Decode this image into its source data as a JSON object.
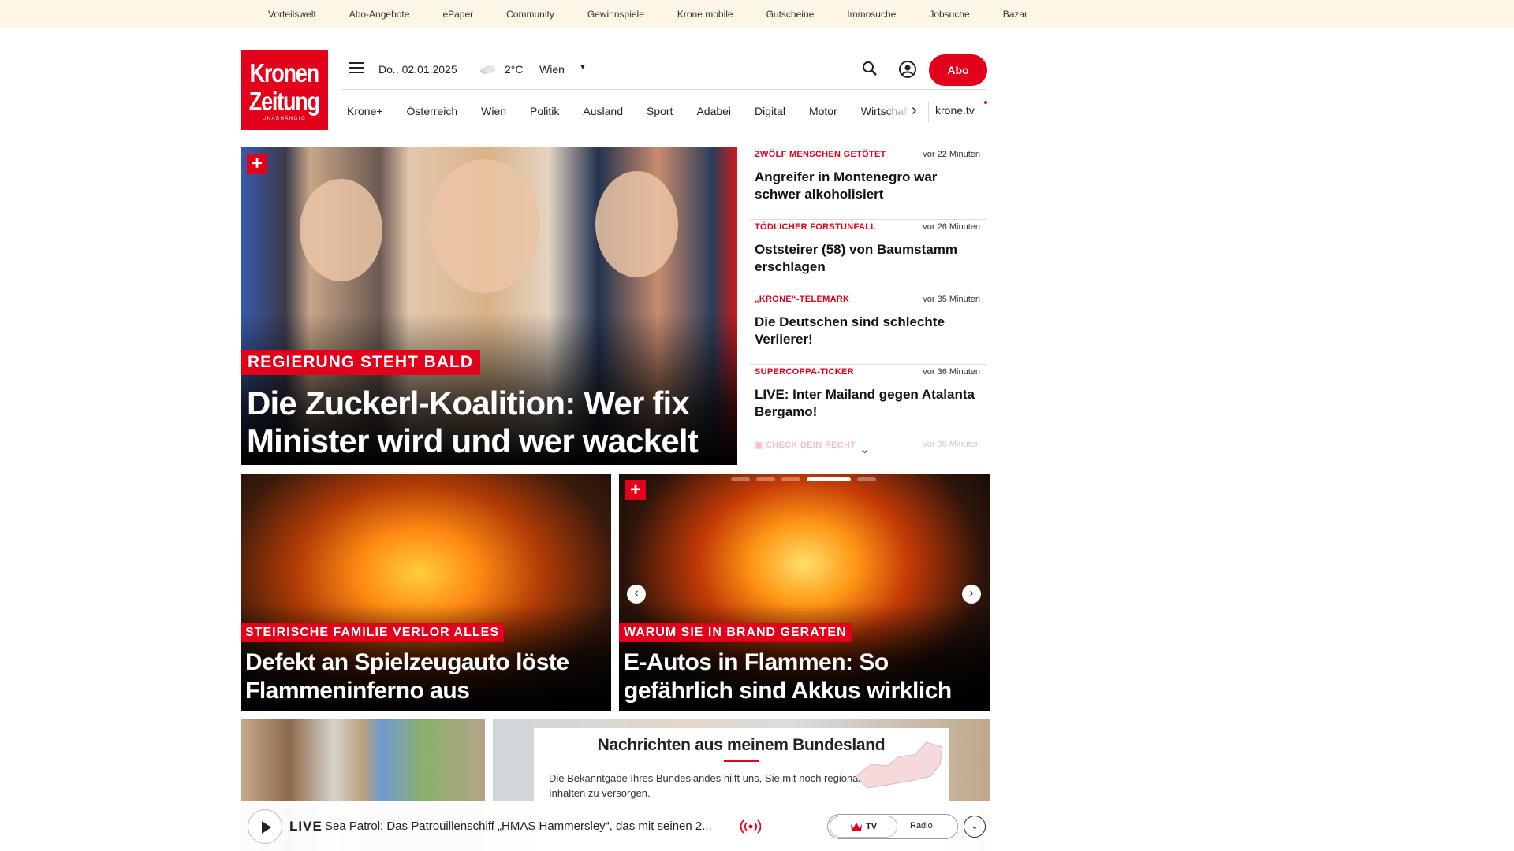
{
  "topbar": {
    "links": [
      "Vorteilswelt",
      "Abo-Angebote",
      "ePaper",
      "Community",
      "Gewinnspiele",
      "Krone mobile",
      "Gutscheine",
      "Immosuche",
      "Jobsuche",
      "Bazar"
    ]
  },
  "logo": {
    "line1": "Kronen",
    "line2": "Zeitung",
    "line3": "UNABHÄNGIG"
  },
  "header": {
    "date": "Do., 02.01.2025",
    "temperature": "2°C",
    "city": "Wien",
    "abo_label": "Abo"
  },
  "nav": {
    "items": [
      "Krone+",
      "Österreich",
      "Wien",
      "Politik",
      "Ausland",
      "Sport",
      "Adabei",
      "Digital",
      "Motor",
      "Wirtschaft"
    ],
    "krone_tv": "krone.tv"
  },
  "hero": {
    "kicker": "REGIERUNG STEHT BALD",
    "title": "Die Zuckerl-Koalition: Wer fix Minister wird und wer wackelt"
  },
  "ticker": {
    "items": [
      {
        "kicker": "ZWÖLF MENSCHEN GETÖTET",
        "time": "vor 22 Minuten",
        "title": "Angreifer in Montenegro war schwer alkoholisiert"
      },
      {
        "kicker": "TÖDLICHER FORSTUNFALL",
        "time": "vor 26 Minuten",
        "title": "Oststeirer (58) von Baumstamm erschlagen"
      },
      {
        "kicker": "„KRONE“-TELEMARK",
        "time": "vor 35 Minuten",
        "title": "Die Deutschen sind schlechte Verlierer!"
      },
      {
        "kicker": "SUPERCOPPA-TICKER",
        "time": "vor 36 Minuten",
        "title": "LIVE: Inter Mailand gegen Atalanta Bergamo!"
      },
      {
        "kicker": "CHECK DEIN RECHT",
        "time": "vor 36 Minuten",
        "title": ""
      }
    ]
  },
  "cards": {
    "left": {
      "kicker": "STEIRISCHE FAMILIE VERLOR ALLES",
      "title": "Defekt an Spielzeugauto löste Flammeninferno aus"
    },
    "right": {
      "kicker": "WARUM SIE IN BRAND GERATEN",
      "title": "E-Autos in Flammen: So gefährlich sind Akkus wirklich"
    }
  },
  "region": {
    "title": "Nachrichten aus meinem Bundesland",
    "text": "Die Bekanntgabe Ihres Bundeslandes hilft uns, Sie mit noch regionaleren Inhalten zu versorgen."
  },
  "livebar": {
    "live_label": "LIVE",
    "text": "Sea Patrol: Das Patrouillenschiff „HMAS Hammersley“, das mit seinen 2...",
    "tv_label": "TV",
    "radio_label": "Radio"
  },
  "colors": {
    "brand_red": "#e2001a",
    "topbar_bg": "#fbf6e6"
  },
  "icons": [
    "hamburger-icon",
    "cloud-icon",
    "chevron-down-icon",
    "search-icon",
    "user-icon",
    "chevron-right-icon",
    "plus-icon",
    "chevron-left-icon",
    "play-icon",
    "radio-wave-icon",
    "crown-icon"
  ]
}
